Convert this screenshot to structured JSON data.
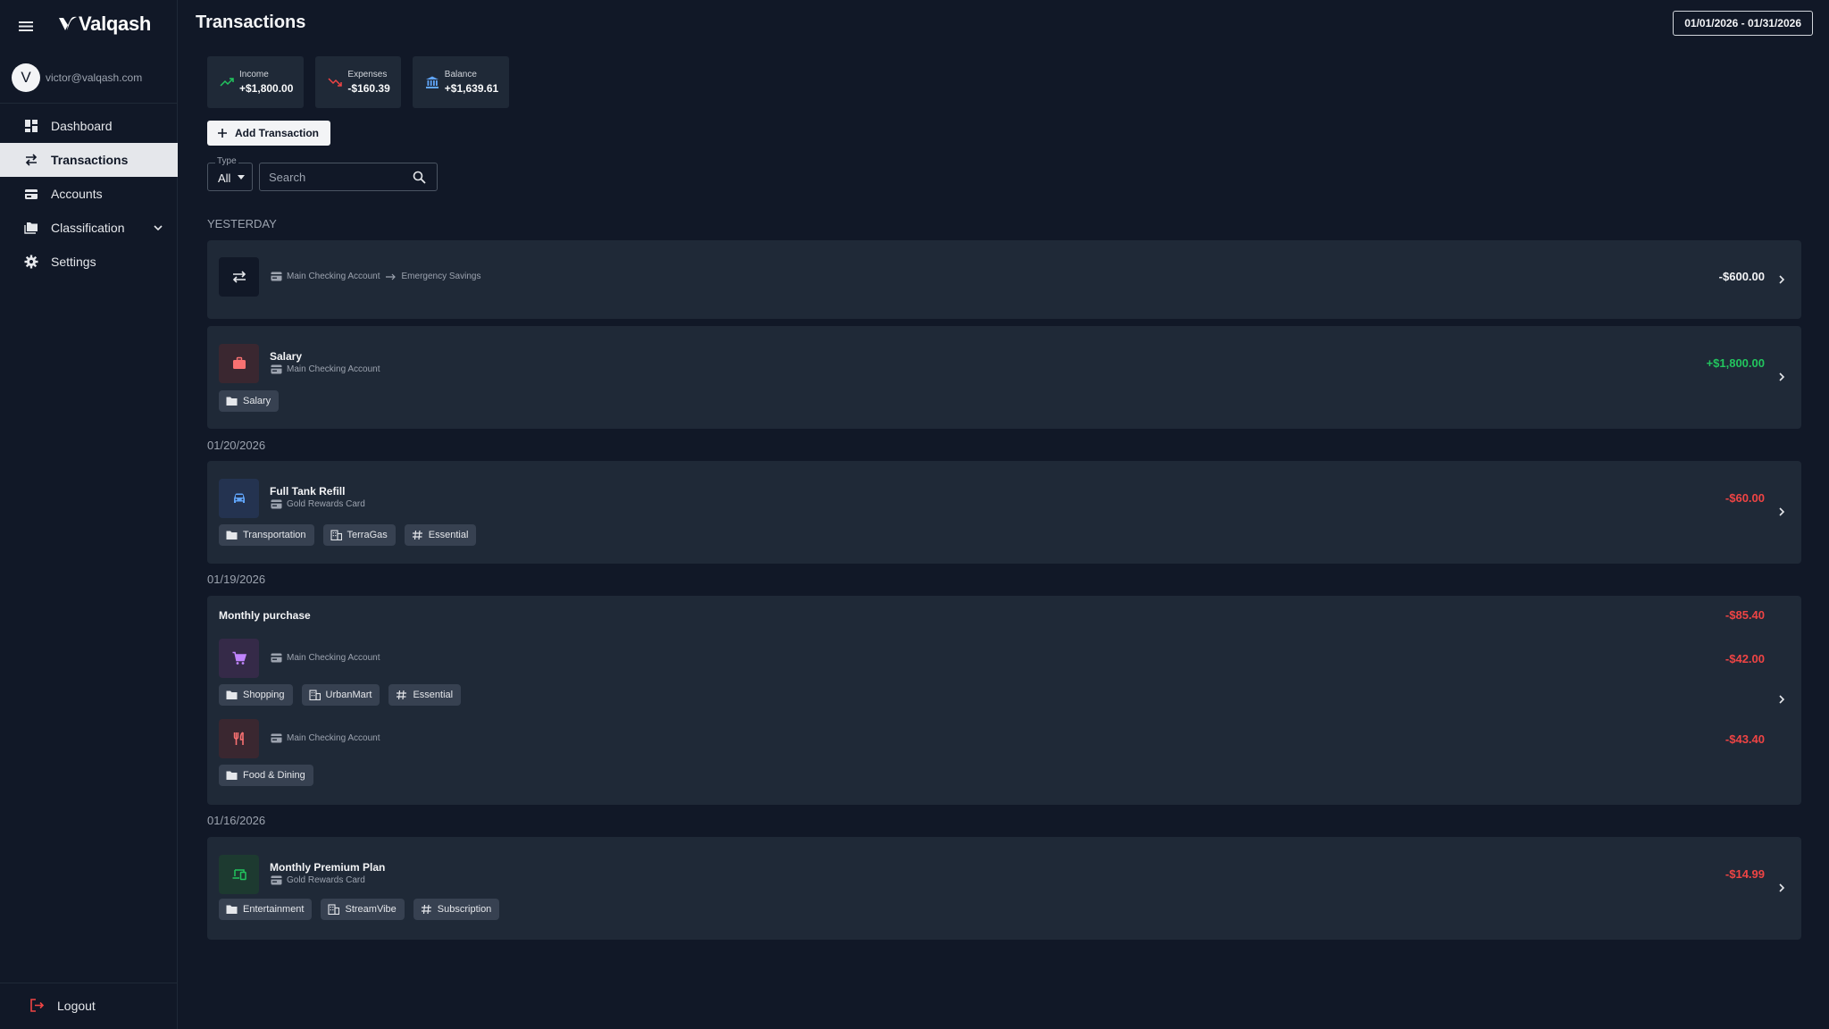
{
  "app": {
    "brand": "Valqash",
    "user_initial": "V",
    "user_email": "victor@valqash.com"
  },
  "nav": {
    "items": [
      {
        "label": "Dashboard",
        "icon": "dashboard-icon"
      },
      {
        "label": "Transactions",
        "icon": "swap-icon",
        "active": true
      },
      {
        "label": "Accounts",
        "icon": "card-icon"
      },
      {
        "label": "Classification",
        "icon": "folders-icon"
      },
      {
        "label": "Settings",
        "icon": "gear-icon"
      }
    ],
    "logout": "Logout"
  },
  "header": {
    "title": "Transactions",
    "date_range": "01/01/2026 - 01/31/2026"
  },
  "summary": {
    "income": {
      "label": "Income",
      "value": "+$1,800.00"
    },
    "expenses": {
      "label": "Expenses",
      "value": "-$160.39"
    },
    "balance": {
      "label": "Balance",
      "value": "+$1,639.61"
    }
  },
  "controls": {
    "add_label": "Add Transaction",
    "type_label": "Type",
    "type_value": "All",
    "search_placeholder": "Search"
  },
  "groups": [
    {
      "label": "YESTERDAY",
      "transactions": [
        {
          "kind": "transfer",
          "from_account": "Main Checking Account",
          "to_account": "Emergency Savings",
          "amount": "-$600.00"
        },
        {
          "name": "Salary",
          "account": "Main Checking Account",
          "amount": "+$1,800.00",
          "tags": [
            "Salary"
          ]
        }
      ]
    },
    {
      "label": "01/20/2026",
      "transactions": [
        {
          "name": "Full Tank Refill",
          "account": "Gold Rewards Card",
          "amount": "-$60.00",
          "tags": [
            "Transportation",
            "TerraGas",
            "Essential"
          ]
        }
      ]
    },
    {
      "label": "01/19/2026",
      "transactions": [
        {
          "name": "Monthly purchase",
          "amount": "-$85.40",
          "splits": [
            {
              "account": "Main Checking Account",
              "amount": "-$42.00",
              "tags": [
                "Shopping",
                "UrbanMart",
                "Essential"
              ]
            },
            {
              "account": "Main Checking Account",
              "amount": "-$43.40",
              "tags": [
                "Food & Dining"
              ]
            }
          ]
        }
      ]
    },
    {
      "label": "01/16/2026",
      "transactions": [
        {
          "name": "Monthly Premium Plan",
          "account": "Gold Rewards Card",
          "amount": "-$14.99",
          "tags": [
            "Entertainment",
            "StreamVibe",
            "Subscription"
          ]
        }
      ]
    }
  ],
  "colors": {
    "background": "#111827",
    "card": "#1f2937",
    "positive": "#22c55e",
    "negative": "#ef4444",
    "accent_blue": "#60a5fa"
  }
}
